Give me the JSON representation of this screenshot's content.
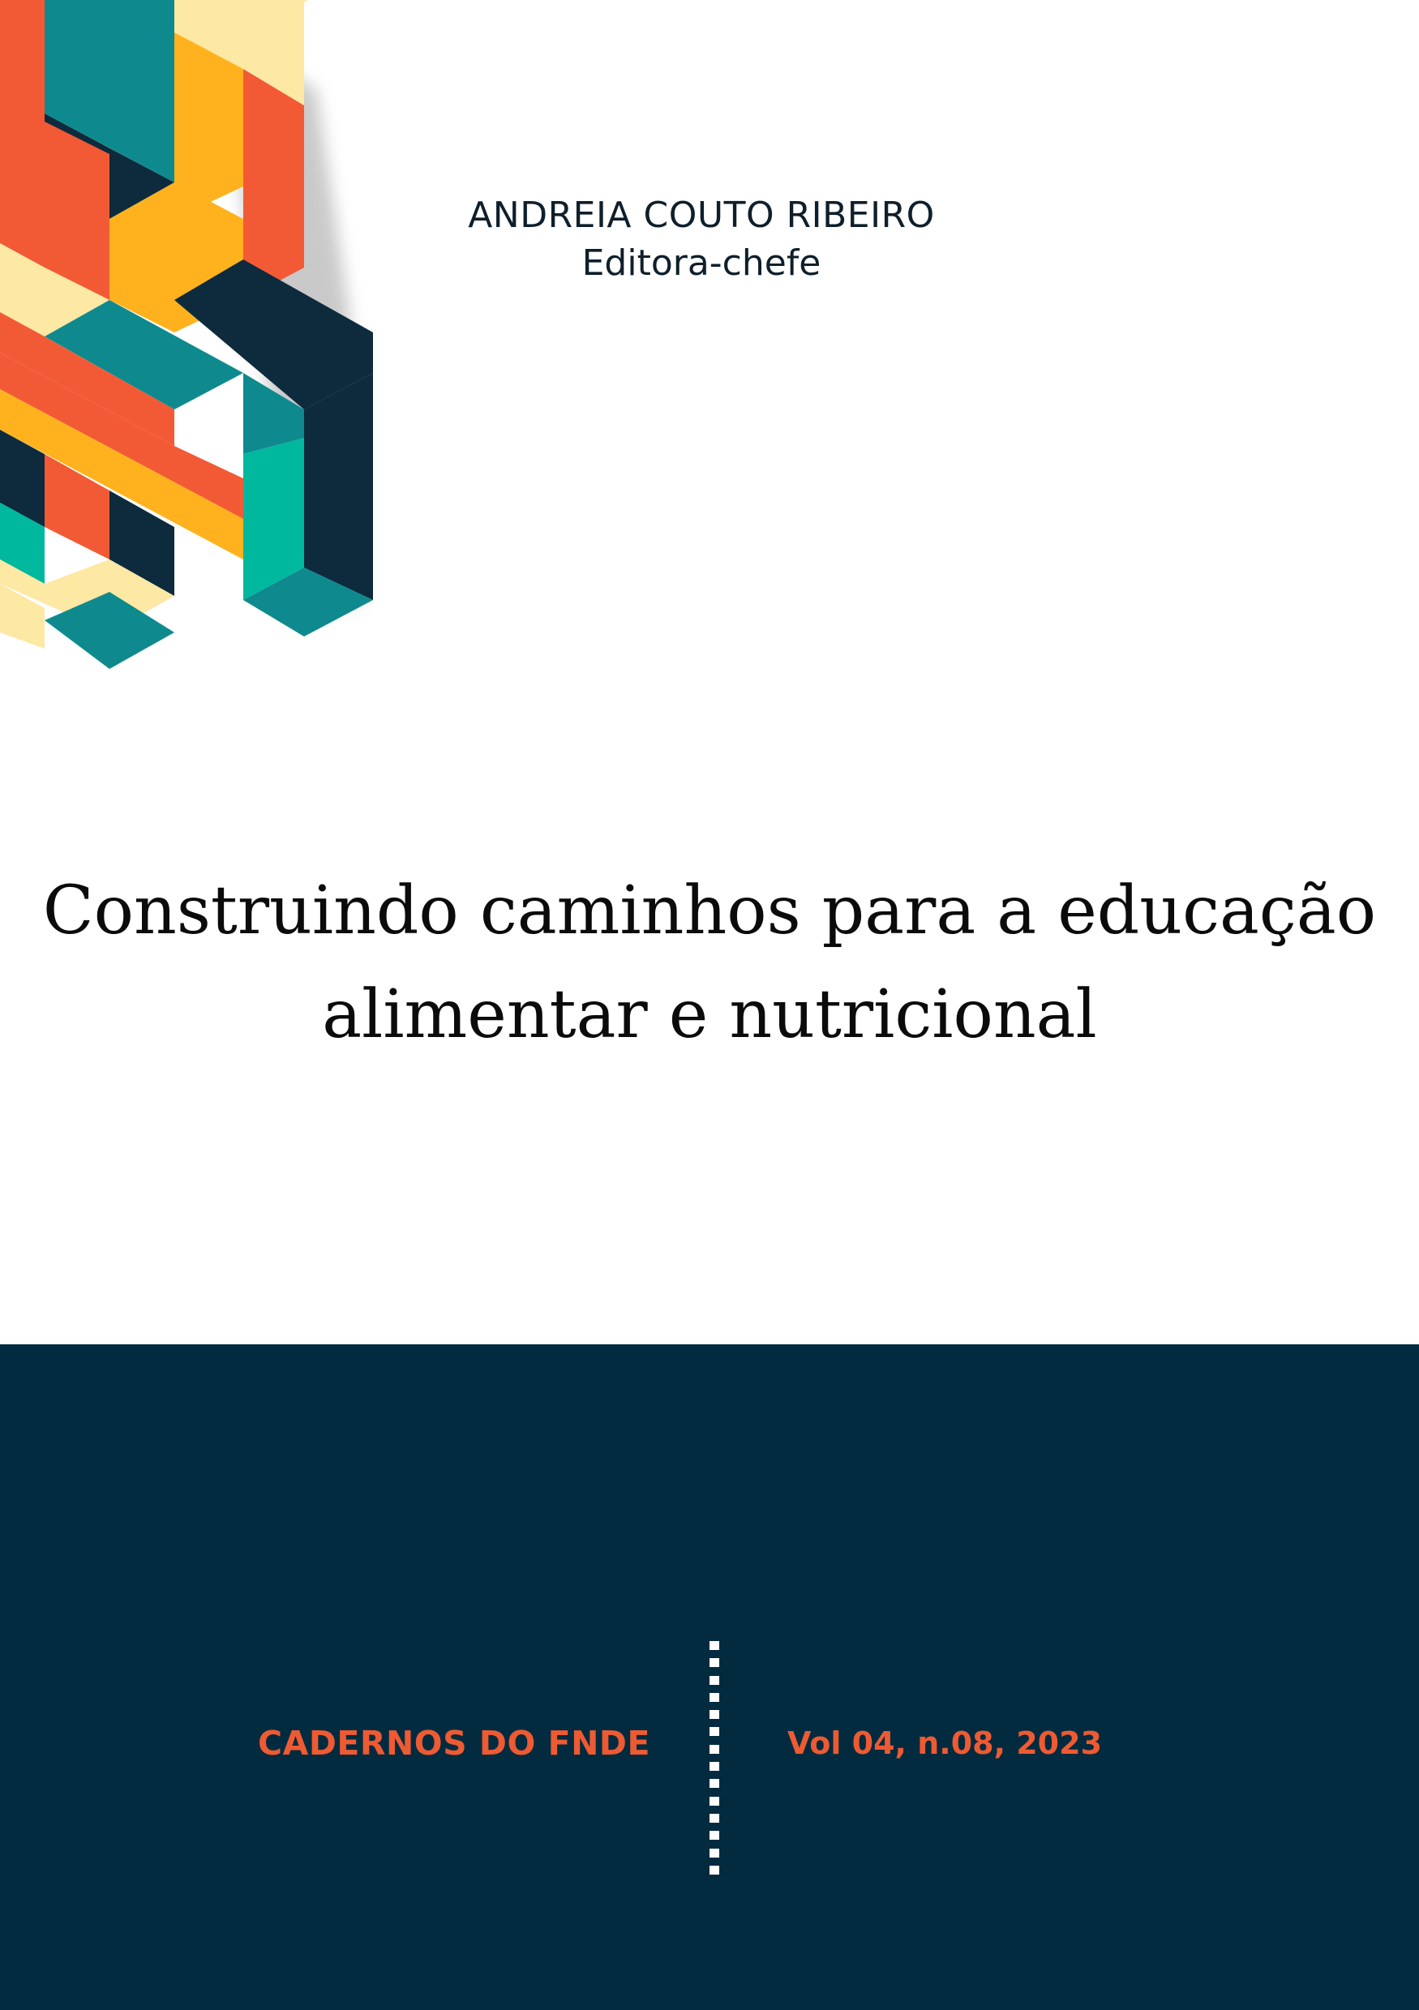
{
  "cover": {
    "editor_name": "ANDREIA COUTO RIBEIRO",
    "editor_role": "Editora-chefe",
    "title_line1": "Construindo caminhos para a educação",
    "title_line2": "alimentar e nutricional",
    "series_name": "CADERNOS DO FNDE",
    "volume": "Vol 04, n.08, 2023"
  },
  "colors": {
    "navy": "#022b40",
    "orange_red": "#f25a36",
    "yellow": "#ffb21e",
    "cream": "#fde8a4",
    "teal": "#0e8a8e",
    "bright_teal": "#00b89e",
    "dark_navy": "#0d2b3d",
    "accent_text": "#ee5a32"
  },
  "icons": [
    "isometric-block-pattern",
    "dotted-divider"
  ]
}
